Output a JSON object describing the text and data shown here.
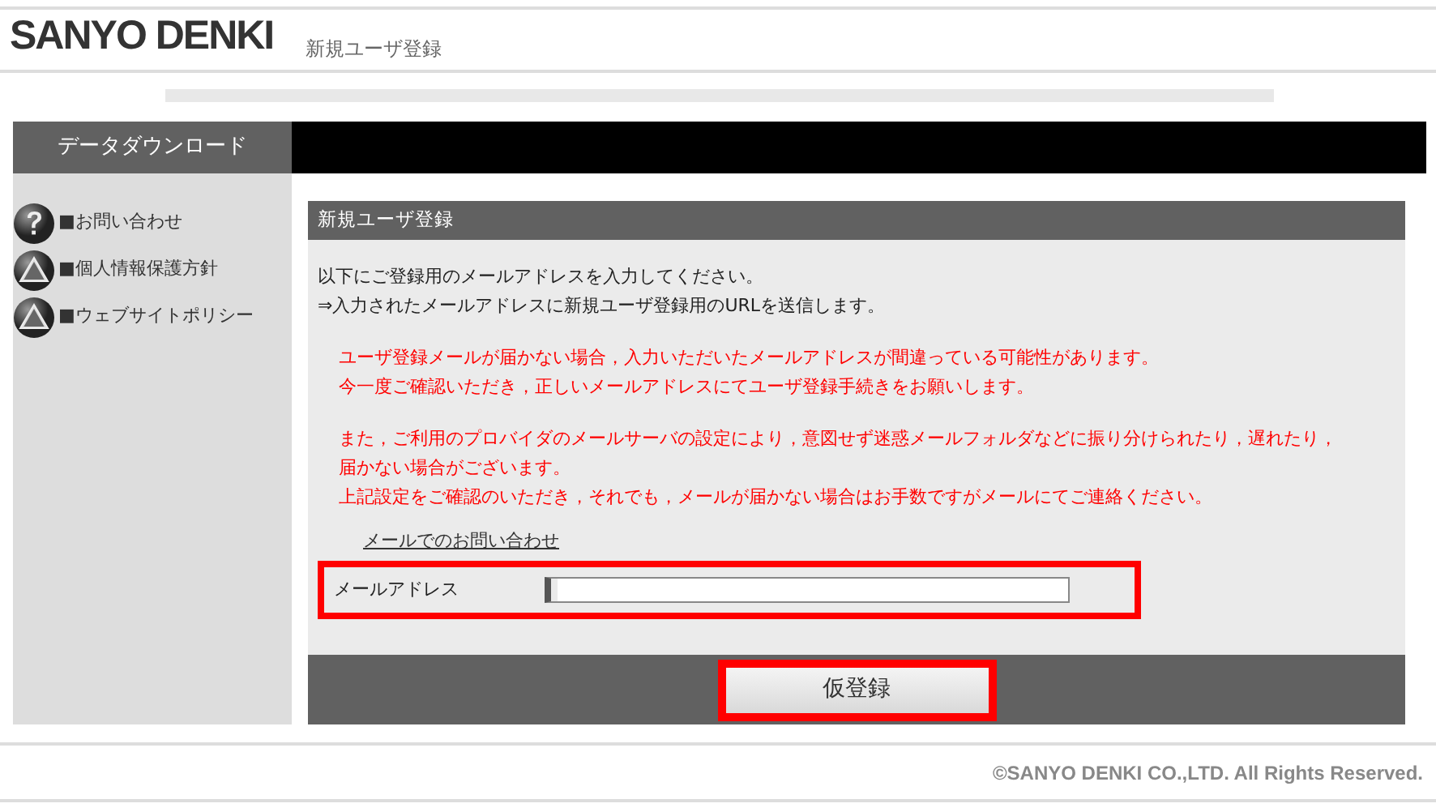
{
  "header": {
    "logo": "SANYO DENKI",
    "page_title": "新規ユーザ登録"
  },
  "sidebar": {
    "title": "データダウンロード",
    "items": [
      {
        "kind": "question",
        "label": "■お問い合わせ"
      },
      {
        "kind": "warning",
        "label": "■個人情報保護方針"
      },
      {
        "kind": "warning",
        "label": "■ウェブサイトポリシー"
      }
    ]
  },
  "panel": {
    "title": "新規ユーザ登録",
    "intro": [
      "以下にご登録用のメールアドレスを入力してください。",
      "⇒入力されたメールアドレスに新規ユーザ登録用のURLを送信します。"
    ],
    "notices": [
      [
        "ユーザ登録メールが届かない場合，入力いただいたメールアドレスが間違っている可能性があります。",
        "今一度ご確認いただき，正しいメールアドレスにてユーザ登録手続きをお願いします。"
      ],
      [
        "また，ご利用のプロバイダのメールサーバの設定により，意図せず迷惑メールフォルダなどに振り分けられたり，遅れたり，",
        "届かない場合がございます。",
        "上記設定をご確認のいただき，それでも，メールが届かない場合はお手数ですがメールにてご連絡ください。"
      ]
    ],
    "contact_link": "メールでのお問い合わせ",
    "field": {
      "label": "メールアドレス",
      "highlighted": true
    },
    "submit": {
      "label": "仮登録",
      "highlighted": true
    }
  },
  "footer": {
    "copyright": "©SANYO DENKI CO.,LTD. All Rights Reserved."
  }
}
